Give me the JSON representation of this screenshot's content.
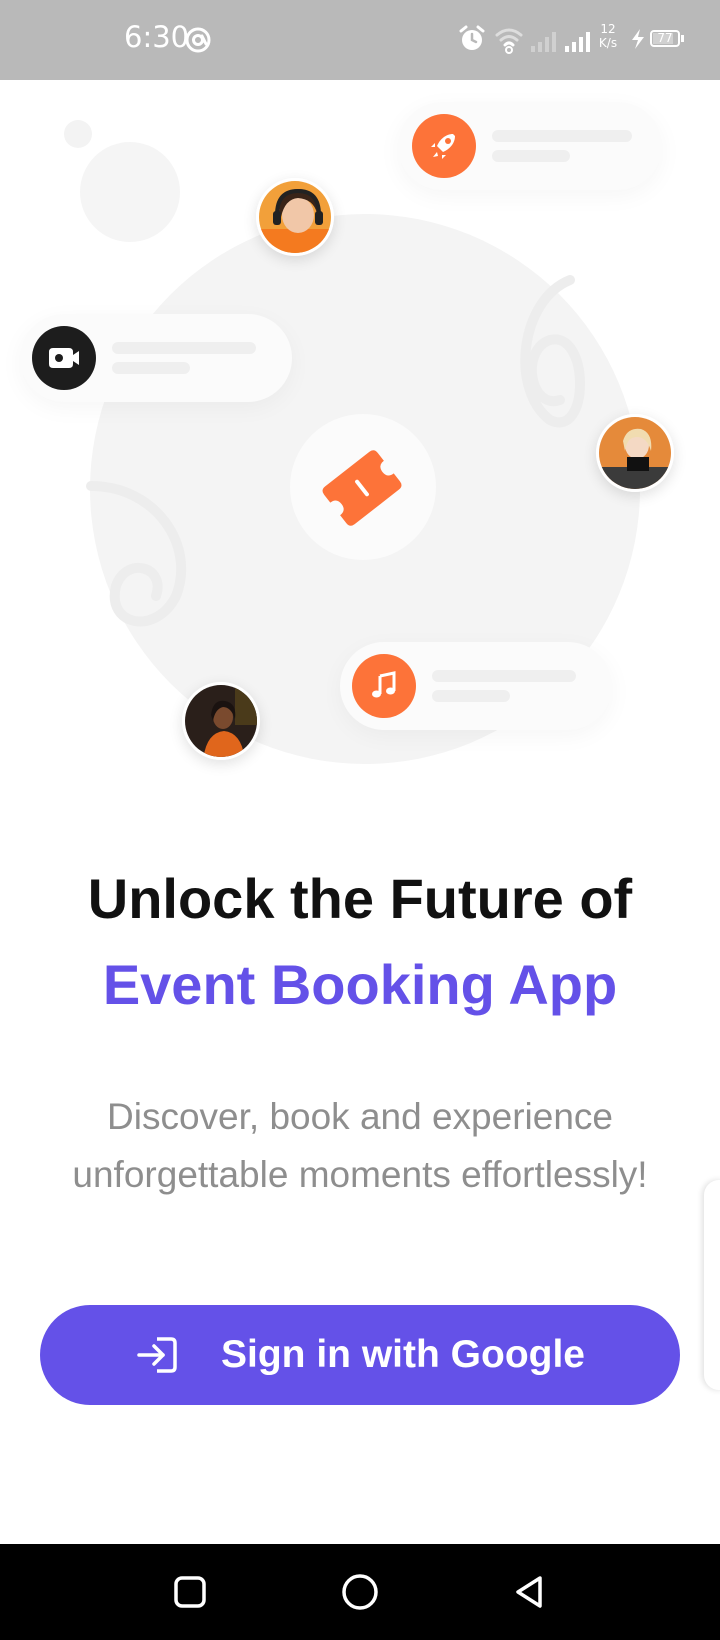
{
  "status_bar": {
    "time": "6:30",
    "network_speed_value": "12",
    "network_speed_unit": "K/s",
    "battery_level": "77",
    "icons": [
      "at-sign-icon",
      "alarm-icon",
      "wifi-icon",
      "signal-weak-icon",
      "signal-icon",
      "charging-bolt-icon",
      "battery-icon"
    ]
  },
  "hero": {
    "icons": [
      "rocket-icon",
      "video-camera-icon",
      "ticket-icon",
      "music-note-icon"
    ],
    "avatars": [
      "avatar-headphones-girl",
      "avatar-dj",
      "avatar-party-girl"
    ],
    "accent_color": "#fd7339"
  },
  "content": {
    "headline_line1": "Unlock the Future of",
    "headline_line2": "Event Booking App",
    "subtitle_line1": "Discover, book and experience",
    "subtitle_line2": "unforgettable moments effortlessly!"
  },
  "signin_button": {
    "label": "Sign in with Google",
    "icon": "login-arrow-icon",
    "color": "#6451e8"
  },
  "nav_bar": {
    "buttons": [
      "recent-apps-button",
      "home-button",
      "back-button"
    ]
  }
}
